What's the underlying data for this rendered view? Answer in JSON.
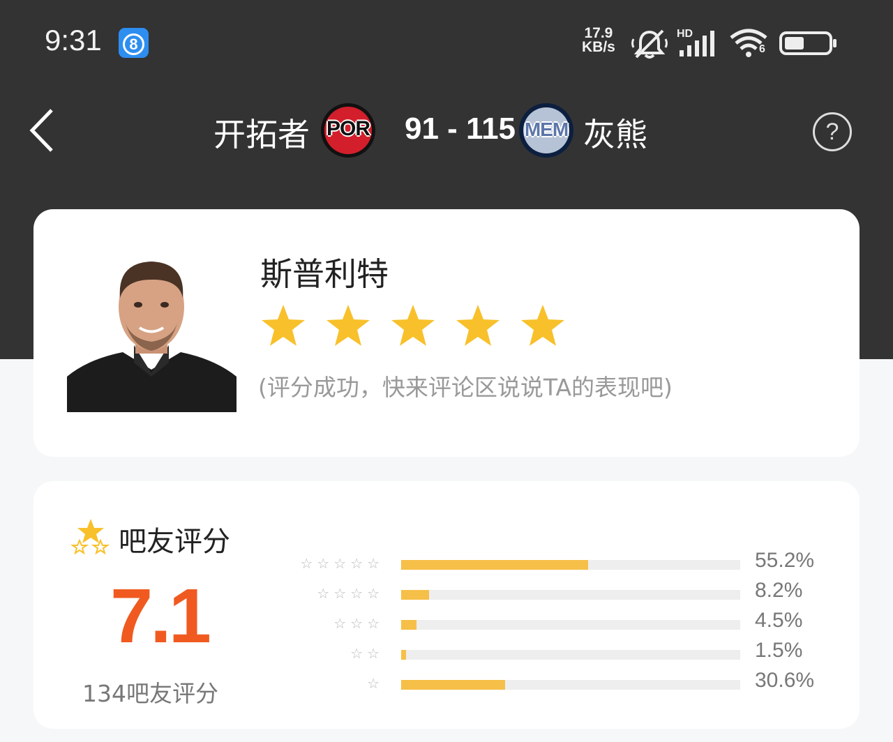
{
  "status_bar": {
    "time": "9:31",
    "notification_app_badge": "8",
    "net_speed_value": "17.9",
    "net_speed_unit": "KB/s",
    "signal_label": "HD",
    "wifi_label": "6",
    "icons": [
      "silent-bell-icon",
      "cell-signal-icon",
      "wifi-icon",
      "battery-icon"
    ],
    "battery_level": 0.45
  },
  "header": {
    "home_team": "开拓者",
    "home_logo_text": "POR",
    "score": "91 - 115",
    "away_logo_text": "MEM",
    "away_team": "灰熊",
    "back_icon": "chevron-left-icon",
    "help_icon": "?"
  },
  "player_card": {
    "name": "斯普利特",
    "my_rating_stars": 5,
    "message": "(评分成功，快来评论区说说TA的表现吧)"
  },
  "fan_rating": {
    "title": "吧友评分",
    "score": "7.1",
    "count_label": "134吧友评分",
    "distribution": [
      {
        "stars": "☆☆☆☆☆",
        "percent": 55.2,
        "label": "55.2%"
      },
      {
        "stars": "☆☆☆☆",
        "percent": 8.2,
        "label": "8.2%"
      },
      {
        "stars": "☆☆☆",
        "percent": 4.5,
        "label": "4.5%"
      },
      {
        "stars": "☆☆",
        "percent": 1.5,
        "label": "1.5%"
      },
      {
        "stars": "☆",
        "percent": 30.6,
        "label": "30.6%"
      }
    ]
  },
  "colors": {
    "header_bg": "#333333",
    "accent_score": "#f05a20",
    "star_gold": "#f6bf48",
    "page_bg": "#f6f7f8"
  }
}
